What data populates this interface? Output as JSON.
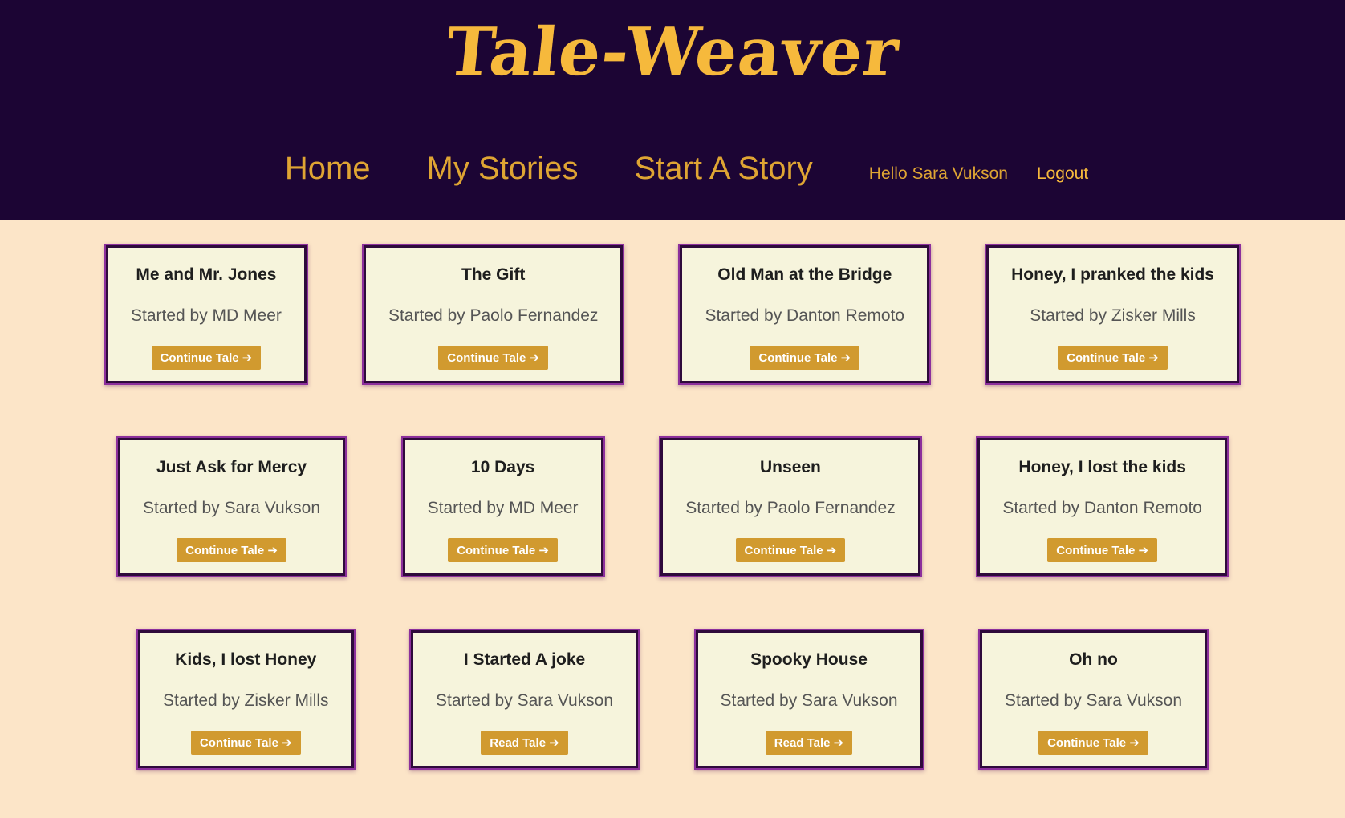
{
  "header": {
    "logo": "Tale-Weaver",
    "nav": {
      "home": "Home",
      "my_stories": "My Stories",
      "start_story": "Start A Story",
      "greeting": "Hello Sara Vukson",
      "logout": "Logout"
    }
  },
  "cards": [
    {
      "title": "Me and Mr. Jones",
      "author": "Started by MD Meer",
      "action": "Continue Tale ➔"
    },
    {
      "title": "The Gift",
      "author": "Started by Paolo Fernandez",
      "action": "Continue Tale ➔"
    },
    {
      "title": "Old Man at the Bridge",
      "author": "Started by Danton Remoto",
      "action": "Continue Tale ➔"
    },
    {
      "title": "Honey, I pranked the kids",
      "author": "Started by Zisker Mills",
      "action": "Continue Tale ➔"
    },
    {
      "title": "Just Ask for Mercy",
      "author": "Started by Sara Vukson",
      "action": "Continue Tale ➔"
    },
    {
      "title": "10 Days",
      "author": "Started by MD Meer",
      "action": "Continue Tale ➔"
    },
    {
      "title": "Unseen",
      "author": "Started by Paolo Fernandez",
      "action": "Continue Tale ➔"
    },
    {
      "title": "Honey, I lost the kids",
      "author": "Started by Danton Remoto",
      "action": "Continue Tale ➔"
    },
    {
      "title": "Kids, I lost Honey",
      "author": "Started by Zisker Mills",
      "action": "Continue Tale ➔"
    },
    {
      "title": "I Started A joke",
      "author": "Started by Sara Vukson",
      "action": "Read Tale ➔"
    },
    {
      "title": "Spooky House",
      "author": "Started by Sara Vukson",
      "action": "Read Tale ➔"
    },
    {
      "title": "Oh no",
      "author": "Started by Sara Vukson",
      "action": "Continue Tale ➔"
    }
  ],
  "colors": {
    "header_bg": "#1c0534",
    "page_bg": "#fce5c8",
    "accent": "#f6b93c",
    "card_bg": "#f6f4dc",
    "card_border": "#2e0a3b",
    "button_bg": "#d19a2f"
  }
}
